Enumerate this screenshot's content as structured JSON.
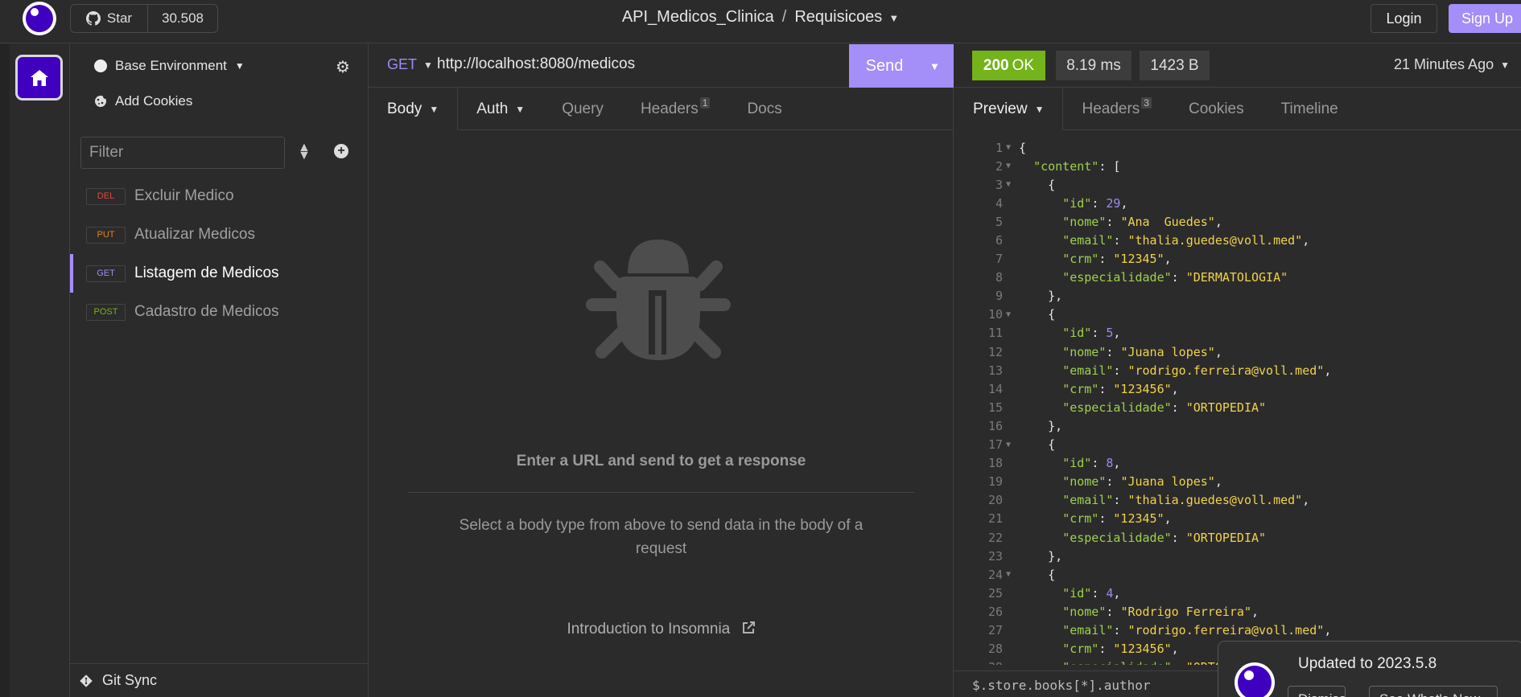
{
  "app": {
    "star_label": "Star",
    "star_count": "30.508",
    "project": "API_Medicos_Clinica",
    "collection": "Requisicoes",
    "login": "Login",
    "signup": "Sign Up"
  },
  "sidebar": {
    "environment": "Base Environment",
    "add_cookies": "Add Cookies",
    "filter_placeholder": "Filter",
    "requests": [
      {
        "method": "DEL",
        "name": "Excluir Medico",
        "color": "#e2453b"
      },
      {
        "method": "PUT",
        "name": "Atualizar Medicos",
        "color": "#e67e22"
      },
      {
        "method": "GET",
        "name": "Listagem de Medicos",
        "color": "#9b8df0",
        "active": true
      },
      {
        "method": "POST",
        "name": "Cadastro de Medicos",
        "color": "#74b319"
      }
    ],
    "git_sync": "Git Sync"
  },
  "request": {
    "method": "GET",
    "url": "http://localhost:8080/medicos",
    "send": "Send",
    "tabs": {
      "body": "Body",
      "auth": "Auth",
      "query": "Query",
      "headers": "Headers",
      "headers_count": "1",
      "docs": "Docs"
    },
    "empty_title": "Enter a URL and send to get a response",
    "empty_sub": "Select a body type from above to send data in the body of a request",
    "intro_link": "Introduction to Insomnia"
  },
  "response": {
    "status_code": "200",
    "status_text": "OK",
    "time": "8.19 ms",
    "size": "1423 B",
    "time_ago": "21 Minutes Ago",
    "tabs": {
      "preview": "Preview",
      "headers": "Headers",
      "headers_count": "3",
      "cookies": "Cookies",
      "timeline": "Timeline"
    },
    "lines": [
      {
        "n": "1",
        "fold": true,
        "parts": [
          [
            "p",
            "{"
          ]
        ]
      },
      {
        "n": "2",
        "fold": true,
        "parts": [
          [
            "p",
            "  "
          ],
          [
            "k",
            "\"content\""
          ],
          [
            "p",
            ": ["
          ]
        ]
      },
      {
        "n": "3",
        "fold": true,
        "parts": [
          [
            "p",
            "    {"
          ]
        ]
      },
      {
        "n": "4",
        "parts": [
          [
            "p",
            "      "
          ],
          [
            "k",
            "\"id\""
          ],
          [
            "p",
            ": "
          ],
          [
            "n",
            "29"
          ],
          [
            "p",
            ","
          ]
        ]
      },
      {
        "n": "5",
        "parts": [
          [
            "p",
            "      "
          ],
          [
            "k",
            "\"nome\""
          ],
          [
            "p",
            ": "
          ],
          [
            "s",
            "\"Ana  Guedes\""
          ],
          [
            "p",
            ","
          ]
        ]
      },
      {
        "n": "6",
        "parts": [
          [
            "p",
            "      "
          ],
          [
            "k",
            "\"email\""
          ],
          [
            "p",
            ": "
          ],
          [
            "s",
            "\"thalia.guedes@voll.med\""
          ],
          [
            "p",
            ","
          ]
        ]
      },
      {
        "n": "7",
        "parts": [
          [
            "p",
            "      "
          ],
          [
            "k",
            "\"crm\""
          ],
          [
            "p",
            ": "
          ],
          [
            "s",
            "\"12345\""
          ],
          [
            "p",
            ","
          ]
        ]
      },
      {
        "n": "8",
        "parts": [
          [
            "p",
            "      "
          ],
          [
            "k",
            "\"especialidade\""
          ],
          [
            "p",
            ": "
          ],
          [
            "s",
            "\"DERMATOLOGIA\""
          ]
        ]
      },
      {
        "n": "9",
        "parts": [
          [
            "p",
            "    },"
          ]
        ]
      },
      {
        "n": "10",
        "fold": true,
        "parts": [
          [
            "p",
            "    {"
          ]
        ]
      },
      {
        "n": "11",
        "parts": [
          [
            "p",
            "      "
          ],
          [
            "k",
            "\"id\""
          ],
          [
            "p",
            ": "
          ],
          [
            "n",
            "5"
          ],
          [
            "p",
            ","
          ]
        ]
      },
      {
        "n": "12",
        "parts": [
          [
            "p",
            "      "
          ],
          [
            "k",
            "\"nome\""
          ],
          [
            "p",
            ": "
          ],
          [
            "s",
            "\"Juana lopes\""
          ],
          [
            "p",
            ","
          ]
        ]
      },
      {
        "n": "13",
        "parts": [
          [
            "p",
            "      "
          ],
          [
            "k",
            "\"email\""
          ],
          [
            "p",
            ": "
          ],
          [
            "s",
            "\"rodrigo.ferreira@voll.med\""
          ],
          [
            "p",
            ","
          ]
        ]
      },
      {
        "n": "14",
        "parts": [
          [
            "p",
            "      "
          ],
          [
            "k",
            "\"crm\""
          ],
          [
            "p",
            ": "
          ],
          [
            "s",
            "\"123456\""
          ],
          [
            "p",
            ","
          ]
        ]
      },
      {
        "n": "15",
        "parts": [
          [
            "p",
            "      "
          ],
          [
            "k",
            "\"especialidade\""
          ],
          [
            "p",
            ": "
          ],
          [
            "s",
            "\"ORTOPEDIA\""
          ]
        ]
      },
      {
        "n": "16",
        "parts": [
          [
            "p",
            "    },"
          ]
        ]
      },
      {
        "n": "17",
        "fold": true,
        "parts": [
          [
            "p",
            "    {"
          ]
        ]
      },
      {
        "n": "18",
        "parts": [
          [
            "p",
            "      "
          ],
          [
            "k",
            "\"id\""
          ],
          [
            "p",
            ": "
          ],
          [
            "n",
            "8"
          ],
          [
            "p",
            ","
          ]
        ]
      },
      {
        "n": "19",
        "parts": [
          [
            "p",
            "      "
          ],
          [
            "k",
            "\"nome\""
          ],
          [
            "p",
            ": "
          ],
          [
            "s",
            "\"Juana lopes\""
          ],
          [
            "p",
            ","
          ]
        ]
      },
      {
        "n": "20",
        "parts": [
          [
            "p",
            "      "
          ],
          [
            "k",
            "\"email\""
          ],
          [
            "p",
            ": "
          ],
          [
            "s",
            "\"thalia.guedes@voll.med\""
          ],
          [
            "p",
            ","
          ]
        ]
      },
      {
        "n": "21",
        "parts": [
          [
            "p",
            "      "
          ],
          [
            "k",
            "\"crm\""
          ],
          [
            "p",
            ": "
          ],
          [
            "s",
            "\"12345\""
          ],
          [
            "p",
            ","
          ]
        ]
      },
      {
        "n": "22",
        "parts": [
          [
            "p",
            "      "
          ],
          [
            "k",
            "\"especialidade\""
          ],
          [
            "p",
            ": "
          ],
          [
            "s",
            "\"ORTOPEDIA\""
          ]
        ]
      },
      {
        "n": "23",
        "parts": [
          [
            "p",
            "    },"
          ]
        ]
      },
      {
        "n": "24",
        "fold": true,
        "parts": [
          [
            "p",
            "    {"
          ]
        ]
      },
      {
        "n": "25",
        "parts": [
          [
            "p",
            "      "
          ],
          [
            "k",
            "\"id\""
          ],
          [
            "p",
            ": "
          ],
          [
            "n",
            "4"
          ],
          [
            "p",
            ","
          ]
        ]
      },
      {
        "n": "26",
        "parts": [
          [
            "p",
            "      "
          ],
          [
            "k",
            "\"nome\""
          ],
          [
            "p",
            ": "
          ],
          [
            "s",
            "\"Rodrigo Ferreira\""
          ],
          [
            "p",
            ","
          ]
        ]
      },
      {
        "n": "27",
        "parts": [
          [
            "p",
            "      "
          ],
          [
            "k",
            "\"email\""
          ],
          [
            "p",
            ": "
          ],
          [
            "s",
            "\"rodrigo.ferreira@voll.med\""
          ],
          [
            "p",
            ","
          ]
        ]
      },
      {
        "n": "28",
        "parts": [
          [
            "p",
            "      "
          ],
          [
            "k",
            "\"crm\""
          ],
          [
            "p",
            ": "
          ],
          [
            "s",
            "\"123456\""
          ],
          [
            "p",
            ","
          ]
        ]
      },
      {
        "n": "29",
        "parts": [
          [
            "p",
            "      "
          ],
          [
            "k",
            "\"especialidade\""
          ],
          [
            "p",
            ": "
          ],
          [
            "s",
            "\"ORTOPEDIA\""
          ]
        ]
      }
    ],
    "filter_query": "$.store.books[*].author"
  },
  "toast": {
    "title": "Updated to 2023.5.8",
    "dismiss": "Dismiss",
    "whats_new": "See What's New"
  },
  "colors": {
    "accent": "#a48ef7",
    "brand": "#4000bf",
    "ok": "#74b319",
    "json_key": "#9ed14b",
    "json_string": "#f0d34b",
    "json_number": "#9b8df0"
  }
}
